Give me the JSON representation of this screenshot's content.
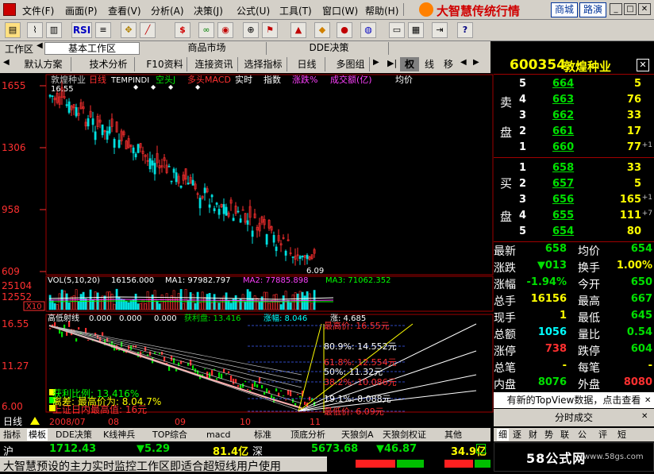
{
  "menu": [
    "文件(F)",
    "画面(P)",
    "查看(V)",
    "分析(A)",
    "决策(J)",
    "公式(U)",
    "工具(T)",
    "窗口(W)",
    "帮助(H)"
  ],
  "brand": "大智慧传统行情",
  "brand_btn1": "商城",
  "brand_btn2": "路演",
  "tabs": {
    "workarea": "工作区",
    "t1": "基本工作区",
    "t2": "商品市场",
    "t3": "DDE决策"
  },
  "toolbar2": [
    "默认方案",
    "技术分析",
    "F10资料",
    "连接资讯",
    "选择指标",
    "日线",
    "多图组"
  ],
  "right_tabs": [
    "权",
    "线",
    "移"
  ],
  "stock": {
    "code": "600354",
    "name": "敦煌种业"
  },
  "chart_header": {
    "name": "敦煌种业",
    "period": "日线",
    "f1": "TEMPINDI",
    "f2": "空头J",
    "f3": "多头MACD",
    "f4": "实时",
    "f5": "指数",
    "f6": "涨跌%",
    "f7": "成交额(亿)",
    "f8": "均价"
  },
  "price_axis": [
    "1655",
    "1306",
    "958",
    "609"
  ],
  "vol_axis": [
    "25104",
    "12552",
    "X10"
  ],
  "ind_axis": [
    "16.55",
    "11.27",
    "6.00"
  ],
  "vol_header": {
    "label": "VOL(5,10,20)",
    "v": "16156.000",
    "ma1": "MA1: 97982.797",
    "ma2": "MA2: 77885.898",
    "ma3": "MA3: 71062.352"
  },
  "ind_header": {
    "label": "高低射线",
    "a": "0.000",
    "b": "0.000",
    "c": "0.000",
    "d": "获利盘: 13.416",
    "e": "涨幅: 8.046",
    "f": "涨: 4.685"
  },
  "fib": [
    {
      "t": "最高价: 16.55元",
      "c": "#ff3030"
    },
    {
      "t": "80.9%: 14.552元",
      "c": "#ffffff"
    },
    {
      "t": "61.8%: 12.554元",
      "c": "#ff3030"
    },
    {
      "t": "50%: 11.32元",
      "c": "#ffffff"
    },
    {
      "t": "38.2%: 10.086元",
      "c": "#ff3030"
    },
    {
      "t": "19.1%: 8.088元",
      "c": "#ffffff"
    },
    {
      "t": "最低价: 6.09元",
      "c": "#ff3030"
    }
  ],
  "overlay_text": [
    "获利比例: 13.416%",
    "离差: 最高价为: 8.04.7%",
    "上证日内最高值: 16元"
  ],
  "price_labels": {
    "hi": "16.55",
    "lo": "6.09"
  },
  "xaxis": [
    "2008/07",
    "08",
    "09",
    "10",
    "11"
  ],
  "period_label": "日线",
  "bottom_tabs": [
    "指标",
    "模板",
    "DDE决策",
    "K线神兵",
    "TOP综合",
    "macd",
    "标准",
    "顶底分析",
    "天狼剑A",
    "天狼剑权证",
    "其他"
  ],
  "orderbook": {
    "sell_label": [
      "卖",
      "盘"
    ],
    "buy_label": [
      "买",
      "盘"
    ],
    "sell": [
      {
        "n": "5",
        "p": "664",
        "v": "5"
      },
      {
        "n": "4",
        "p": "663",
        "v": "76"
      },
      {
        "n": "3",
        "p": "662",
        "v": "33"
      },
      {
        "n": "2",
        "p": "661",
        "v": "17"
      },
      {
        "n": "1",
        "p": "660",
        "v": "77",
        "d": "+1"
      }
    ],
    "buy": [
      {
        "n": "1",
        "p": "658",
        "v": "33"
      },
      {
        "n": "2",
        "p": "657",
        "v": "5"
      },
      {
        "n": "3",
        "p": "656",
        "v": "165",
        "d": "+1"
      },
      {
        "n": "4",
        "p": "655",
        "v": "111",
        "d": "+7"
      },
      {
        "n": "5",
        "p": "654",
        "v": "80"
      }
    ]
  },
  "stats": [
    {
      "l": "最新",
      "v": "658",
      "c": "#00e000",
      "l2": "均价",
      "v2": "654",
      "c2": "#00e000"
    },
    {
      "l": "涨跌",
      "v": "▼013",
      "c": "#00e000",
      "l2": "换手",
      "v2": "1.00%",
      "c2": "#ffff00"
    },
    {
      "l": "涨幅",
      "v": "-1.94%",
      "c": "#00e000",
      "l2": "今开",
      "v2": "650",
      "c2": "#00e000"
    },
    {
      "l": "总手",
      "v": "16156",
      "c": "#ffff00",
      "l2": "最高",
      "v2": "667",
      "c2": "#00e000"
    },
    {
      "l": "现手",
      "v": "1",
      "c": "#ffff00",
      "l2": "最低",
      "v2": "645",
      "c2": "#00e000"
    },
    {
      "l": "总额",
      "v": "1056",
      "c": "#00ffff",
      "l2": "量比",
      "v2": "0.54",
      "c2": "#00e000"
    },
    {
      "l": "涨停",
      "v": "738",
      "c": "#ff3030",
      "l2": "跌停",
      "v2": "604",
      "c2": "#00e000"
    },
    {
      "l": "总笔",
      "v": "-",
      "c": "#ffff00",
      "l2": "每笔",
      "v2": "-",
      "c2": "#ffff00"
    },
    {
      "l": "内盘",
      "v": "8076",
      "c": "#00e000",
      "l2": "外盘",
      "v2": "8080",
      "c2": "#ff3030"
    }
  ],
  "topview": "有新的TopView数据，点击查看",
  "fenshi": "分时成交",
  "rp_tabs": [
    "细",
    "逐",
    "财",
    "势",
    "联",
    "公",
    "评",
    "短"
  ],
  "status": {
    "idx1_name": "沪",
    "idx1_val": "1712.43",
    "idx1_chg": "▼5.29",
    "idx1_amt": "81.4亿",
    "idx2_name": "深",
    "idx2_val": "5673.68",
    "idx2_chg": "▼46.87",
    "idx2_amt": "34.9亿",
    "ticker": "大智慧预设的主力实时监控工作区即适合超短线用户使用",
    "watermark": "58公式网",
    "watermark_url": "www.58gs.com"
  }
}
